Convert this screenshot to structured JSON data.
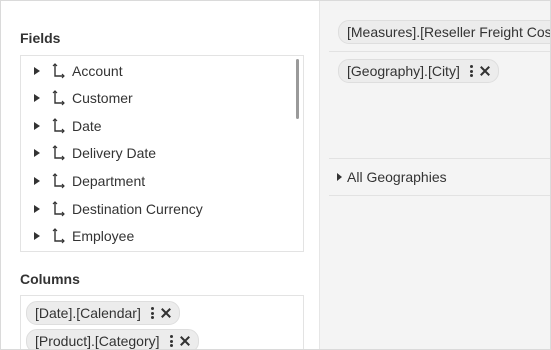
{
  "fields_panel": {
    "title": "Fields",
    "items": [
      {
        "label": "Account"
      },
      {
        "label": "Customer"
      },
      {
        "label": "Date"
      },
      {
        "label": "Delivery Date"
      },
      {
        "label": "Department"
      },
      {
        "label": "Destination Currency"
      },
      {
        "label": "Employee"
      }
    ]
  },
  "columns_panel": {
    "title": "Columns",
    "chips": [
      {
        "label": "[Date].[Calendar]"
      },
      {
        "label": "[Product].[Category]"
      }
    ]
  },
  "right_panel": {
    "measures_chip": "[Measures].[Reseller Freight Cost]",
    "rows_chip": "[Geography].[City]",
    "row_header": "All Geographies"
  },
  "icons": {
    "expand": "caret-right-icon",
    "hierarchy": "hierarchy-icon",
    "menu": "more-vertical-icon",
    "remove": "close-icon"
  }
}
